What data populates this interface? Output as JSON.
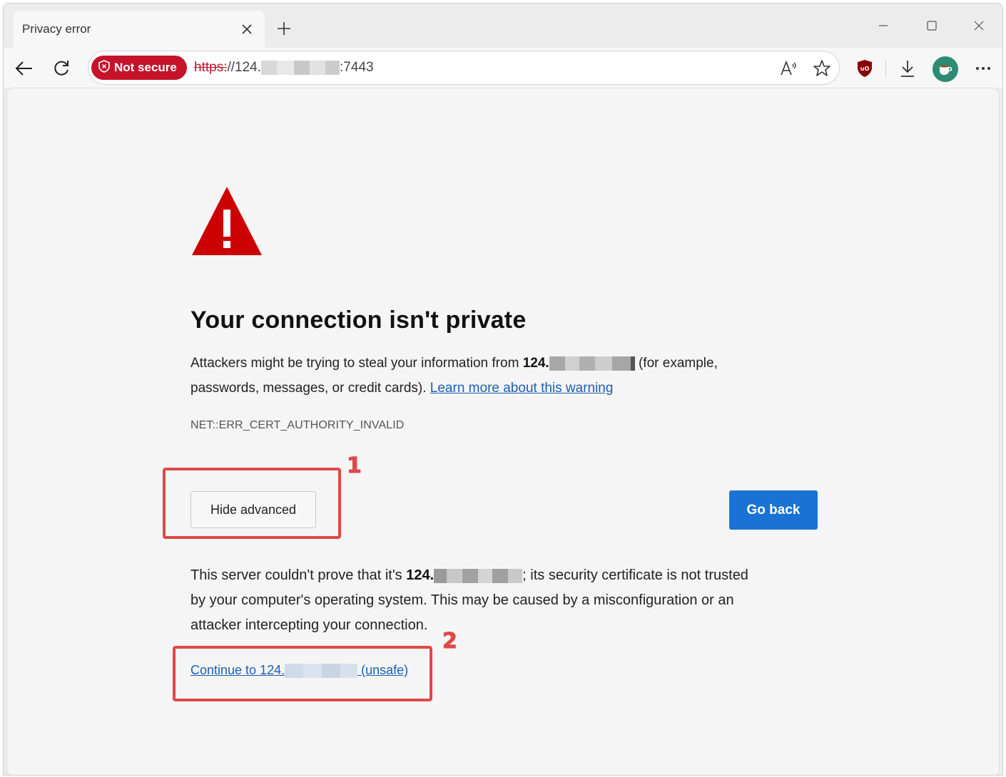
{
  "tab": {
    "title": "Privacy error",
    "close_icon": "close-icon"
  },
  "window_controls": [
    "minimize-icon",
    "maximize-icon",
    "close-icon"
  ],
  "toolbar": {
    "security_label": "Not secure",
    "url_scheme": "https:",
    "url_rest_prefix": "//124.",
    "url_port": ":7443",
    "icons": [
      "back-icon",
      "refresh-icon",
      "read-aloud-icon",
      "favorite-star-icon",
      "ublock-icon",
      "download-icon",
      "profile-avatar",
      "more-icon"
    ]
  },
  "page": {
    "heading": "Your connection isn't private",
    "intro_prefix": "Attackers might be trying to steal your information from",
    "intro_host": "124.",
    "intro_suffix_line1": "(for example,",
    "intro_line2": "passwords, messages, or credit cards).",
    "learn_more": "Learn more about this warning",
    "error_code": "NET::ERR_CERT_AUTHORITY_INVALID",
    "hide_advanced": "Hide advanced",
    "go_back": "Go back",
    "detail_prefix": "This server couldn't prove that it's",
    "detail_host": "124.",
    "detail_suffix": "; its security certificate is not trusted",
    "detail_line2": "by your computer's operating system. This may be caused by a misconfiguration or an",
    "detail_line3": "attacker intercepting your connection.",
    "continue_prefix": "Continue to 124.",
    "continue_suffix": "(unsafe)"
  },
  "annotations": {
    "step1": "1",
    "step2": "2",
    "color": "#e04848"
  },
  "colors": {
    "not_secure": "#c4132b",
    "link": "#1a5fb4",
    "primary_button": "#1a73d4",
    "warning_icon": "#cc0000"
  }
}
